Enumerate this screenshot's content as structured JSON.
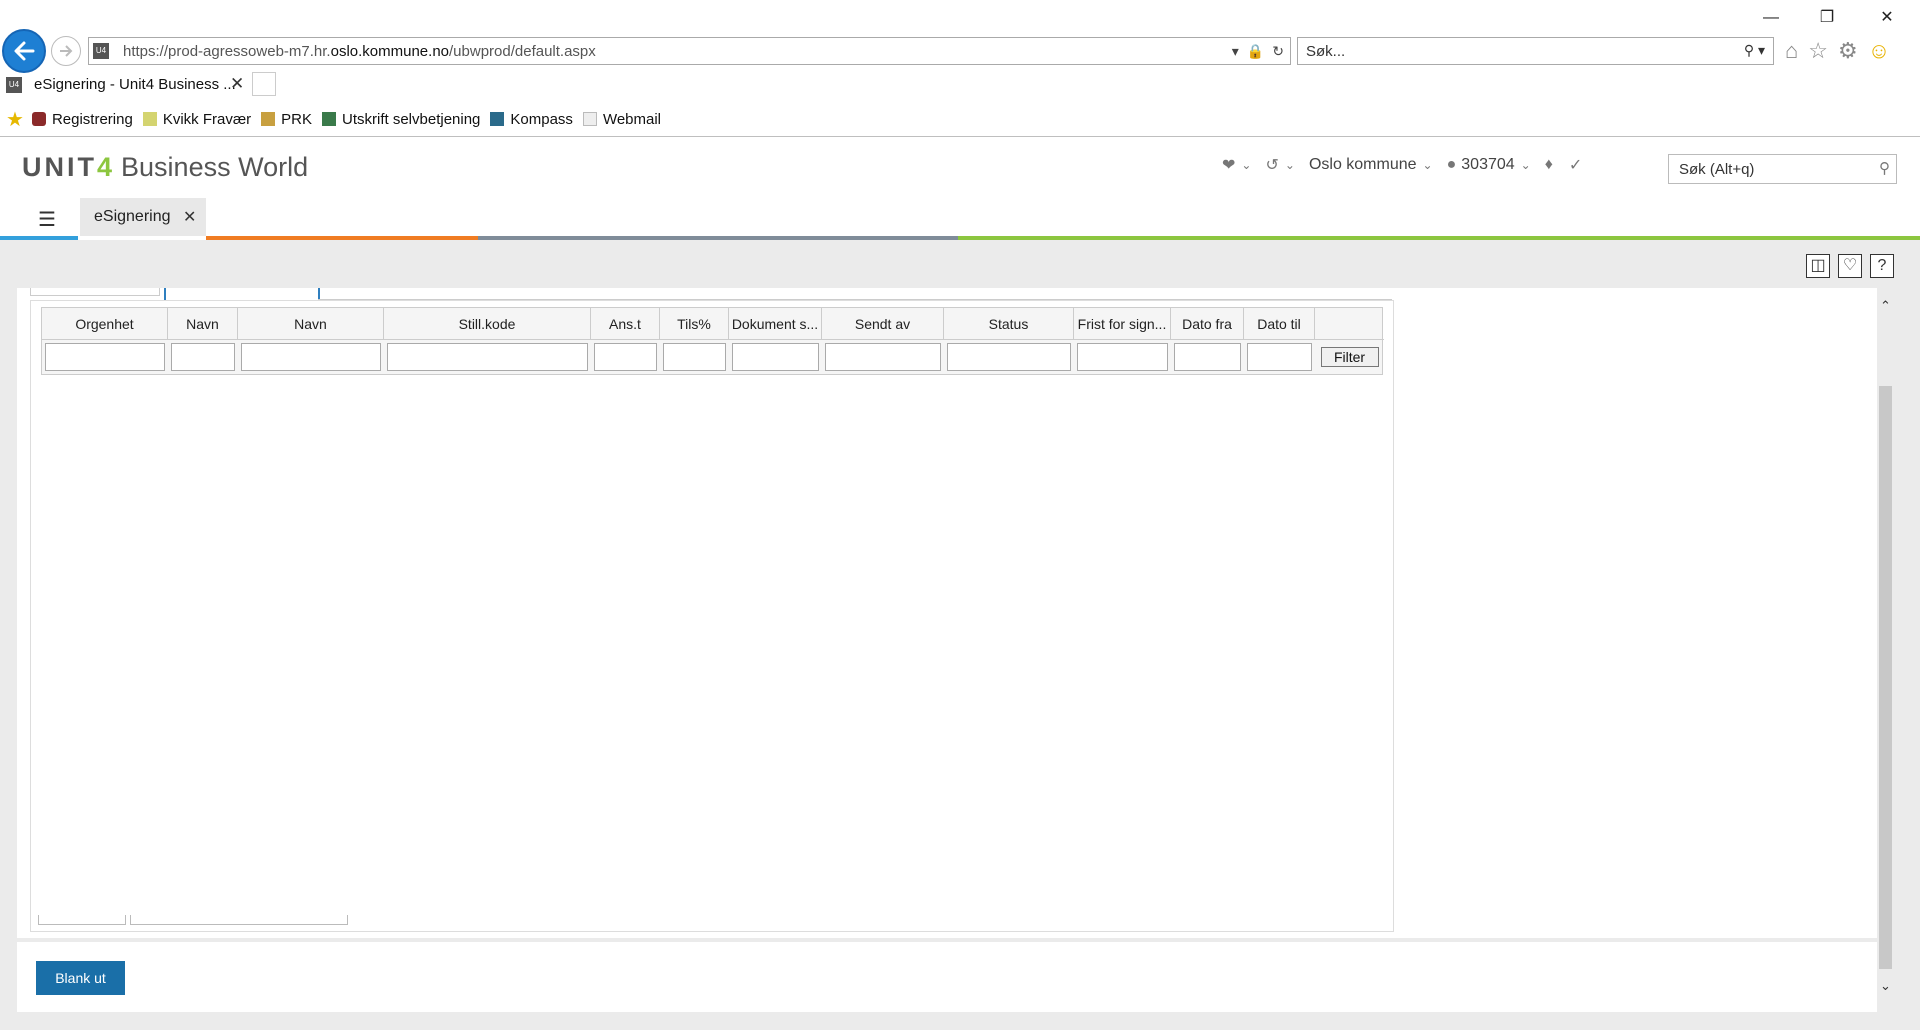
{
  "browser": {
    "url_prefix": "https://prod-agressoweb-m7.hr.",
    "url_domain": "oslo.kommune.no",
    "url_path": "/ubwprod/default.aspx",
    "search_placeholder": "Søk...",
    "tab_title": "eSignering - Unit4 Business ...",
    "favicon_text": "U4",
    "favorites": [
      "Registrering",
      "Kvikk Fravær",
      "PRK",
      "Utskrift selvbetjening",
      "Kompass",
      "Webmail"
    ]
  },
  "app": {
    "logo_brand": "UNIT",
    "logo_digit": "4",
    "logo_product": "Business World",
    "company": "Oslo kommune",
    "user_id": "303704",
    "search_placeholder": "Søk (Alt+q)",
    "tab_title": "eSignering"
  },
  "grid": {
    "columns": [
      "Orgenhet",
      "Navn",
      "Navn",
      "Still.kode",
      "Ans.t",
      "Tils%",
      "Dokument s...",
      "Sendt av",
      "Status",
      "Frist for sign...",
      "Dato fra",
      "Dato til"
    ],
    "filter_button": "Filter",
    "rows": []
  },
  "footer": {
    "blank_button": "Blank ut"
  },
  "colors": {
    "accent_blue": "#1a6fa8",
    "stripe_blue": "#33a0dc",
    "stripe_orange": "#f07c22",
    "stripe_gray": "#7f8c99",
    "stripe_green": "#8cc63f"
  }
}
